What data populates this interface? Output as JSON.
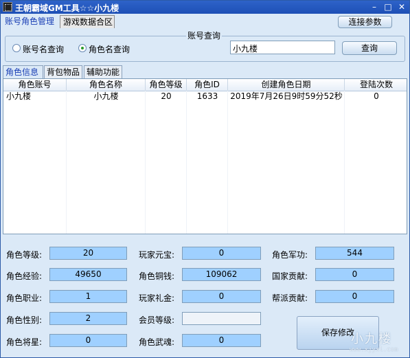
{
  "window": {
    "title": "王朝霸域GM工具☆☆小九楼",
    "minimize_glyph": "–",
    "maximize_glyph": "□",
    "close_glyph": "✕"
  },
  "top_tabs": [
    {
      "label": "账号角色管理"
    },
    {
      "label": "游戏数据合区"
    }
  ],
  "connect_button": "连接参数",
  "query_group": {
    "title": "账号查询",
    "radio_account": "账号名查询",
    "radio_role": "角色名查询",
    "input_value": "小九楼",
    "query_button": "查询"
  },
  "sub_tabs": [
    {
      "label": "角色信息"
    },
    {
      "label": "背包物品"
    },
    {
      "label": "辅助功能"
    }
  ],
  "table": {
    "headers": [
      "角色账号",
      "角色名称",
      "角色等级",
      "角色ID",
      "创建角色日期",
      "登陆次数"
    ],
    "rows": [
      [
        "小九楼",
        "小九楼",
        "20",
        "1633",
        "2019年7月26日9时59分52秒",
        "0"
      ]
    ]
  },
  "fields": {
    "level_label": "角色等级:",
    "level": "20",
    "exp_label": "角色经验:",
    "exp": "49650",
    "job_label": "角色职业:",
    "job": "1",
    "gender_label": "角色性别:",
    "gender": "2",
    "general_label": "角色将星:",
    "general": "0",
    "yuanbao_label": "玩家元宝:",
    "yuanbao": "0",
    "copper_label": "角色铜钱:",
    "copper": "109062",
    "gift_label": "玩家礼金:",
    "gift": "0",
    "vip_label": "会员等级:",
    "vip": "",
    "soul_label": "角色武魂:",
    "soul": "0",
    "merit_label": "角色军功:",
    "merit": "544",
    "nation_label": "国家贡献:",
    "nation": "0",
    "faction_label": "帮派贡献:",
    "faction": "0"
  },
  "save_button": "保存修改",
  "watermark": "小九楼",
  "watermark_url": "www.xjyxl.com"
}
